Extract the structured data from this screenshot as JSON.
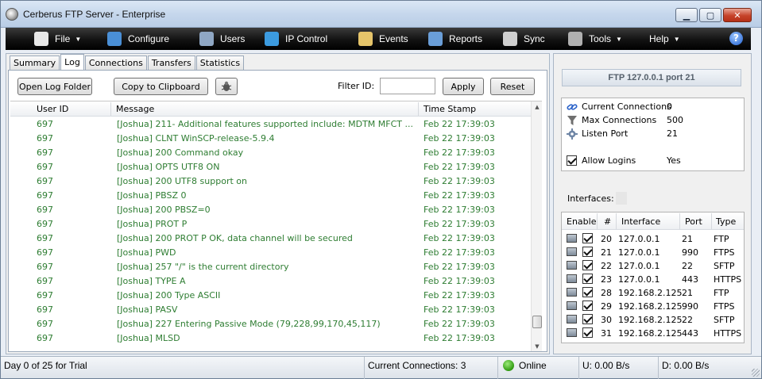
{
  "window": {
    "title": "Cerberus FTP Server - Enterprise",
    "minimize": "▁",
    "maximize": "▢",
    "close": "✕"
  },
  "menu": [
    {
      "label": "File",
      "icon": "file-icon",
      "color": "#e8e8e8",
      "caret": true
    },
    {
      "label": "Configure",
      "icon": "monitor-icon",
      "color": "#4a8fd6",
      "caret": false
    },
    {
      "label": "Users",
      "icon": "user-icon",
      "color": "#8fa7c4",
      "caret": false
    },
    {
      "label": "IP Control",
      "icon": "globe-icon",
      "color": "#3c9be0",
      "caret": false
    },
    {
      "label": "Events",
      "icon": "folder-icon",
      "color": "#e5c46a",
      "caret": false
    },
    {
      "label": "Reports",
      "icon": "chart-icon",
      "color": "#6a9ed8",
      "caret": false
    },
    {
      "label": "Sync",
      "icon": "sync-icon",
      "color": "#cfcfcf",
      "caret": false
    },
    {
      "label": "Tools",
      "icon": "tools-icon",
      "color": "#b0b0b0",
      "caret": true
    },
    {
      "label": "Help",
      "icon": "",
      "color": "",
      "caret": true
    }
  ],
  "help_icon_glyph": "?",
  "tabs": [
    "Summary",
    "Log",
    "Connections",
    "Transfers",
    "Statistics"
  ],
  "active_tab": "Log",
  "log_toolbar": {
    "open_folder": "Open Log Folder",
    "copy": "Copy to Clipboard",
    "filter_label": "Filter ID:",
    "filter_value": "",
    "apply": "Apply",
    "reset": "Reset"
  },
  "log_columns": [
    "User ID",
    "Message",
    "Time Stamp"
  ],
  "log_rows": [
    {
      "uid": "697",
      "msg": "[Joshua] 211- Additional features supported include:  MDTM   MFCT ...",
      "ts": "Feb 22 17:39:03"
    },
    {
      "uid": "697",
      "msg": "[Joshua] CLNT WinSCP-release-5.9.4",
      "ts": "Feb 22 17:39:03"
    },
    {
      "uid": "697",
      "msg": "[Joshua] 200 Command okay",
      "ts": "Feb 22 17:39:03"
    },
    {
      "uid": "697",
      "msg": "[Joshua] OPTS UTF8 ON",
      "ts": "Feb 22 17:39:03"
    },
    {
      "uid": "697",
      "msg": "[Joshua] 200 UTF8 support on",
      "ts": "Feb 22 17:39:03"
    },
    {
      "uid": "697",
      "msg": "[Joshua] PBSZ 0",
      "ts": "Feb 22 17:39:03"
    },
    {
      "uid": "697",
      "msg": "[Joshua] 200 PBSZ=0",
      "ts": "Feb 22 17:39:03"
    },
    {
      "uid": "697",
      "msg": "[Joshua] PROT P",
      "ts": "Feb 22 17:39:03"
    },
    {
      "uid": "697",
      "msg": "[Joshua] 200 PROT P OK, data channel will be secured",
      "ts": "Feb 22 17:39:03"
    },
    {
      "uid": "697",
      "msg": "[Joshua] PWD",
      "ts": "Feb 22 17:39:03"
    },
    {
      "uid": "697",
      "msg": "[Joshua] 257 \"/\" is the current directory",
      "ts": "Feb 22 17:39:03"
    },
    {
      "uid": "697",
      "msg": "[Joshua] TYPE A",
      "ts": "Feb 22 17:39:03"
    },
    {
      "uid": "697",
      "msg": "[Joshua] 200 Type ASCII",
      "ts": "Feb 22 17:39:03"
    },
    {
      "uid": "697",
      "msg": "[Joshua] PASV",
      "ts": "Feb 22 17:39:03"
    },
    {
      "uid": "697",
      "msg": "[Joshua] 227 Entering Passive Mode (79,228,99,170,45,117)",
      "ts": "Feb 22 17:39:03"
    },
    {
      "uid": "697",
      "msg": "[Joshua] MLSD",
      "ts": "Feb 22 17:39:03"
    }
  ],
  "server": {
    "title": "FTP 127.0.0.1 port 21",
    "current_connections_label": "Current Connections",
    "current_connections": "0",
    "max_connections_label": "Max Connections",
    "max_connections": "500",
    "listen_port_label": "Listen Port",
    "listen_port": "21",
    "allow_logins_label": "Allow Logins",
    "allow_logins": "Yes"
  },
  "interfaces_label": "Interfaces:",
  "iface_columns": [
    "Enable",
    "#",
    "Interface",
    "Port",
    "Type"
  ],
  "interfaces": [
    {
      "num": "20",
      "ip": "127.0.0.1",
      "port": "21",
      "type": "FTP"
    },
    {
      "num": "21",
      "ip": "127.0.0.1",
      "port": "990",
      "type": "FTPS"
    },
    {
      "num": "22",
      "ip": "127.0.0.1",
      "port": "22",
      "type": "SFTP"
    },
    {
      "num": "23",
      "ip": "127.0.0.1",
      "port": "443",
      "type": "HTTPS"
    },
    {
      "num": "28",
      "ip": "192.168.2.125",
      "port": "21",
      "type": "FTP"
    },
    {
      "num": "29",
      "ip": "192.168.2.125",
      "port": "990",
      "type": "FTPS"
    },
    {
      "num": "30",
      "ip": "192.168.2.125",
      "port": "22",
      "type": "SFTP"
    },
    {
      "num": "31",
      "ip": "192.168.2.125",
      "port": "443",
      "type": "HTTPS"
    }
  ],
  "status": {
    "trial": "Day 0 of 25 for Trial",
    "connections": "Current Connections: 3",
    "online": "Online",
    "upload": "U: 0.00 B/s",
    "download": "D: 0.00 B/s"
  }
}
